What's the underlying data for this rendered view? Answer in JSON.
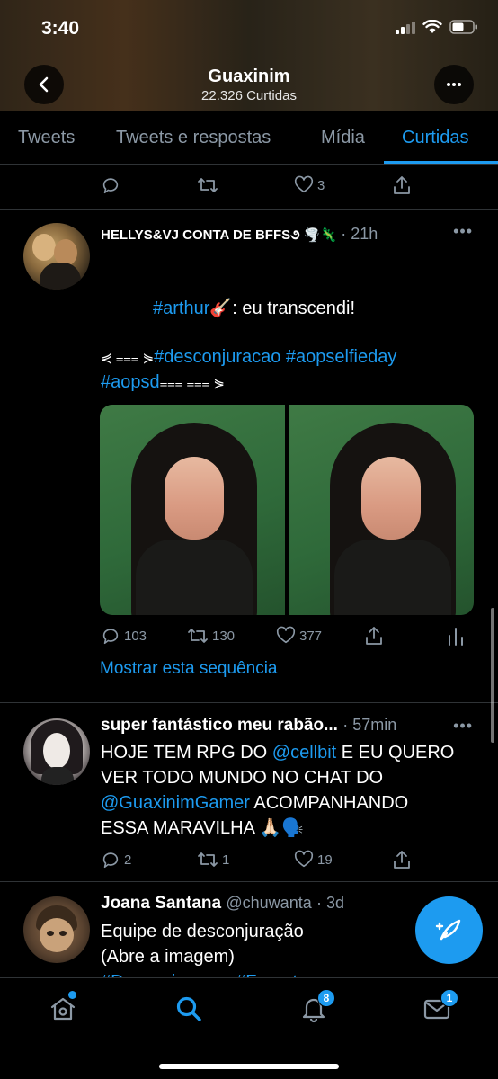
{
  "status_bar": {
    "time": "3:40"
  },
  "header": {
    "title": "Guaxinim",
    "subtitle": "22.326 Curtidas"
  },
  "tabs": [
    {
      "label": "Tweets"
    },
    {
      "label": "Tweets e respostas"
    },
    {
      "label": "Mídia"
    },
    {
      "label": "Curtidas",
      "active": true
    }
  ],
  "prev_tweet": {
    "likes": "3"
  },
  "tweet1": {
    "name": "HELLYS&VJ CONTA DE BFFS૭ 🌪️🦎",
    "time": "· 21h",
    "hashtag_arthur": "#arthur🎸",
    "text_line1_rest": ": eu transcendi!",
    "deco_left": "⋞ ⩶ ⋟",
    "hashtags_line2": "#desconjuracao #aopselfieday",
    "hashtag_line3": "#aopsd",
    "deco_right": "⩶ ⩶ ⋟",
    "replies": "103",
    "retweets": "130",
    "likes": "377",
    "show_thread": "Mostrar esta sequência"
  },
  "tweet2": {
    "name": "super fantástico meu rabão...",
    "time": "· 57min",
    "line1_a": "HOJE TEM RPG DO ",
    "line1_mention": "@cellbit",
    "line1_b": " E EU QUERO",
    "line2": "VER TODO MUNDO NO CHAT DO",
    "line3_mention": "@GuaxinimGamer",
    "line3_b": " ACOMPANHANDO",
    "line4": "ESSA MARAVILHA 🙏🏻🗣️",
    "replies": "2",
    "retweets": "1",
    "likes": "19"
  },
  "tweet3": {
    "name": "Joana Santana",
    "handle": "@chuwanta",
    "time": "· 3d",
    "line1": "Equipe de desconjuração",
    "line2": "(Abre a imagem)",
    "line3": "#Desconjuracao #Fanart"
  },
  "bottom_nav": {
    "notifications_badge": "8",
    "messages_badge": "1"
  },
  "colors": {
    "accent": "#1d9bf0",
    "muted": "#8b98a5",
    "background": "#000000"
  }
}
